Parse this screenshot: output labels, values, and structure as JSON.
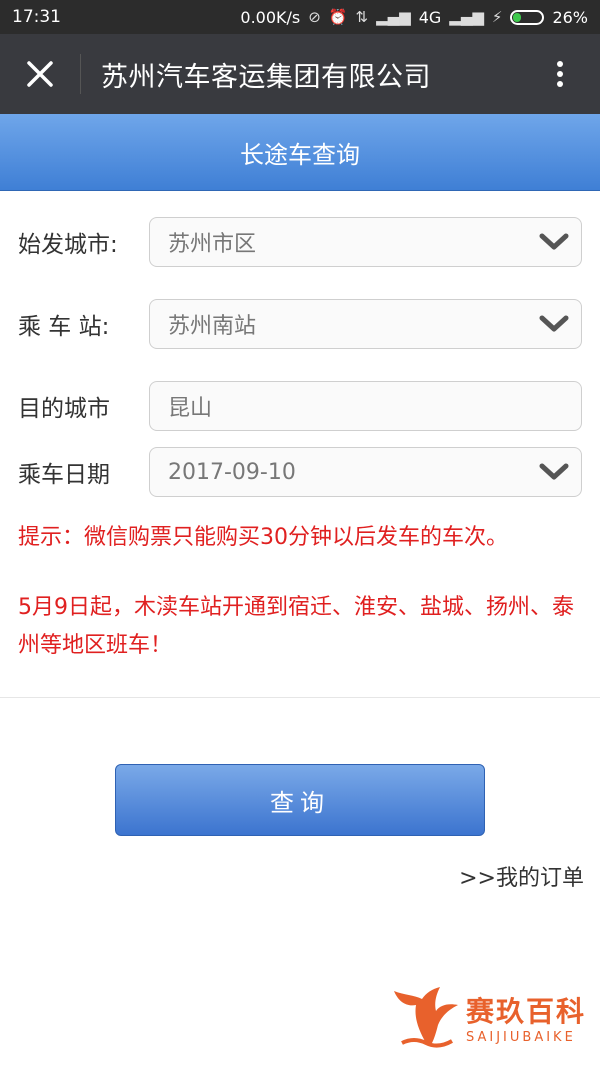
{
  "statusbar": {
    "time": "17:31",
    "net_speed": "0.00K/s",
    "network": "4G",
    "battery": "26%",
    "battery_level": 0.26
  },
  "titlebar": {
    "title": "苏州汽车客运集团有限公司"
  },
  "header": {
    "title": "长途车查询"
  },
  "form": {
    "departure_city": {
      "label": "始发城市:",
      "value": "苏州市区"
    },
    "station": {
      "label": "乘 车 站:",
      "value": "苏州南站"
    },
    "destination": {
      "label": "目的城市",
      "value": "昆山"
    },
    "date": {
      "label": "乘车日期",
      "value": "2017-09-10"
    }
  },
  "notice": {
    "line1": "提示：微信购票只能购买30分钟以后发车的车次。",
    "line2": "5月9日起，木渎车站开通到宿迁、淮安、盐城、扬州、泰州等地区班车！"
  },
  "actions": {
    "query_label": "查询",
    "my_orders": ">>我的订单"
  },
  "watermark": {
    "cn": "赛玖百科",
    "en": "SAIJIUBAIKE"
  },
  "colors": {
    "header_blue": "#4a88dc",
    "notice_red": "#e02020",
    "watermark_orange": "#e8612c"
  }
}
